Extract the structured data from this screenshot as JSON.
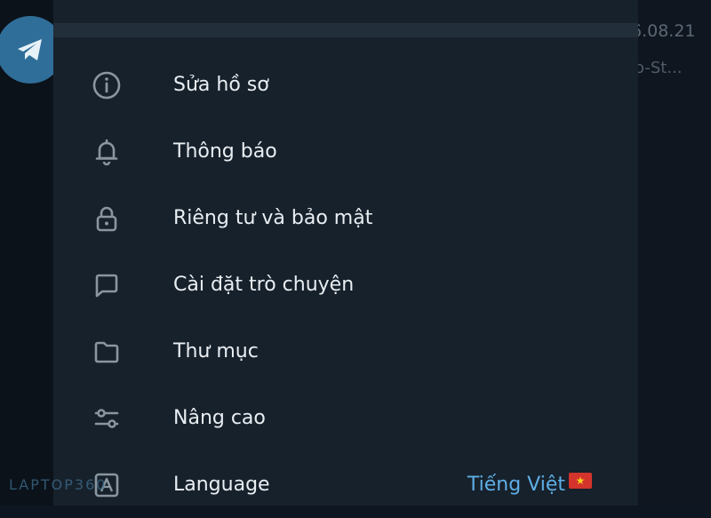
{
  "background": {
    "date_text": "6.08.21",
    "preview_text": "o-St..."
  },
  "menu": {
    "items": [
      {
        "label": "Sửa hồ sơ",
        "icon": "info-icon"
      },
      {
        "label": "Thông báo",
        "icon": "bell-icon"
      },
      {
        "label": "Riêng tư và bảo mật",
        "icon": "lock-icon"
      },
      {
        "label": "Cài đặt trò chuyện",
        "icon": "chat-bubble-icon"
      },
      {
        "label": "Thư mục",
        "icon": "folder-icon"
      },
      {
        "label": "Nâng cao",
        "icon": "sliders-icon"
      },
      {
        "label": "Language",
        "icon": "language-icon",
        "value": "Tiếng Việt"
      }
    ]
  },
  "watermark": "LAPTOP360",
  "colors": {
    "panel_bg": "#17212b",
    "accent": "#5eaee6",
    "icon": "#8a969f",
    "text": "#e9eef3"
  }
}
